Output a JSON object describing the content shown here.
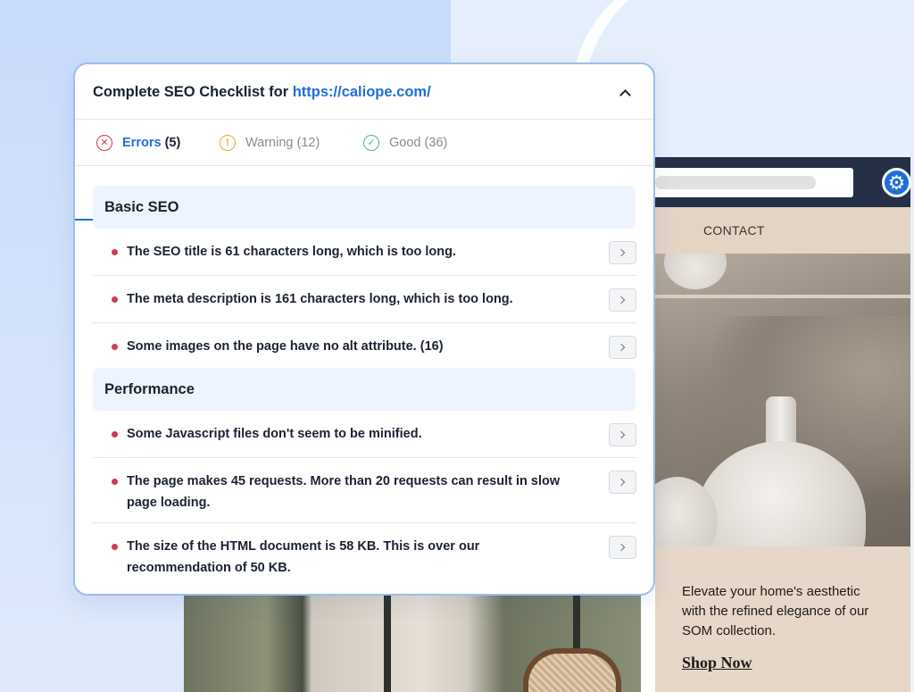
{
  "panel": {
    "title_prefix": "Complete SEO Checklist for ",
    "title_url": "https://caliope.com/",
    "tabs": [
      {
        "label": "Errors",
        "count": "(5)",
        "icon": "x-circle-icon",
        "color": "#d23a4a",
        "active": true
      },
      {
        "label": "Warning",
        "count": "(12)",
        "icon": "exclamation-circle-icon",
        "color": "#e8a33a",
        "active": false
      },
      {
        "label": "Good",
        "count": "(36)",
        "icon": "check-circle-icon",
        "color": "#53b483",
        "active": false
      }
    ],
    "sections": [
      {
        "title": "Basic SEO",
        "items": [
          "The SEO title is 61 characters long, which is too long.",
          "The meta description is 161 characters long, which is too long.",
          "Some images on the page have no alt attribute. (16)"
        ]
      },
      {
        "title": "Performance",
        "items": [
          "Some Javascript files don't seem to be minified.",
          "The page makes 45 requests. More than 20 requests can result in slow page loading.",
          "The size of the HTML document is 58 KB. This is over our recommendation of 50 KB."
        ]
      }
    ]
  },
  "website": {
    "nav_contact": "CONTACT",
    "promo_text": "Elevate your home's aesthetic with the refined elegance of our SOM collection.",
    "promo_link": "Shop Now"
  },
  "colors": {
    "accent": "#1f6fd6",
    "error": "#d23a4a",
    "warning": "#e8a33a",
    "good": "#53b483"
  }
}
